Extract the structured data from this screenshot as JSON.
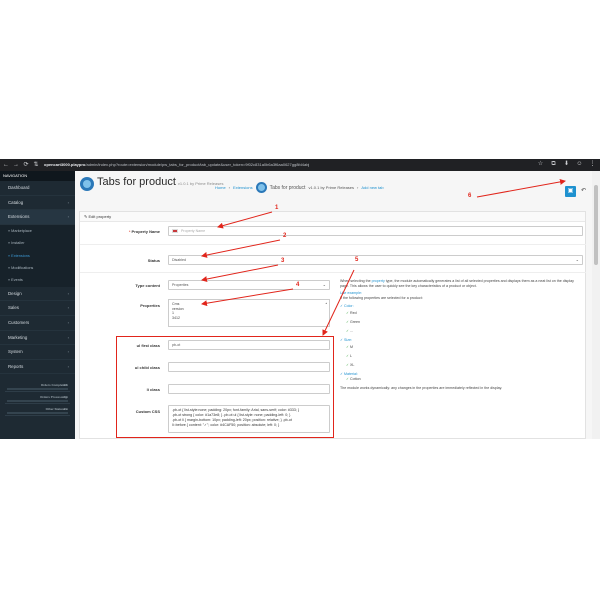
{
  "browser": {
    "url_host": "opencart3000.playpro",
    "url_path": "/admin/index.php?route=extension/module/pw_tabs_for_product/tab_update&user_token=9f02c831a0b6a3f6aa0627gg8fd4abj",
    "buttons": [
      "←",
      "→",
      "⟳",
      "⇅"
    ],
    "right_icons": [
      "☆",
      "⧉",
      "⬇",
      "☺",
      "⋮"
    ]
  },
  "nav": {
    "header": "NAVIGATION",
    "items": [
      {
        "label": "Dashboard",
        "arrow": ""
      },
      {
        "label": "Catalog",
        "arrow": "›"
      },
      {
        "label": "Extensions",
        "arrow": "›"
      },
      {
        "label": "Design",
        "arrow": "›"
      },
      {
        "label": "Sales",
        "arrow": "›"
      },
      {
        "label": "Customers",
        "arrow": "›"
      },
      {
        "label": "Marketing",
        "arrow": "›"
      },
      {
        "label": "System",
        "arrow": "›"
      },
      {
        "label": "Reports",
        "arrow": "›"
      }
    ],
    "subitems": [
      "» Marketplace",
      "» Installer",
      "» Extensions",
      "» Modifications",
      "» Events"
    ],
    "stats": [
      {
        "label": "Orders Completed",
        "pct": "0%",
        "value": 0.0
      },
      {
        "label": "Orders Processing",
        "pct": "0%",
        "value": 0.0
      },
      {
        "label": "Other Statuses",
        "pct": "0%",
        "value": 0.0
      }
    ]
  },
  "header": {
    "title": "Tabs for product",
    "version": "v1.0.1 by Prime Releases",
    "crumb_home": "Home",
    "crumb_ext": "Extensions",
    "crumb_module": "Tabs for product",
    "crumb_module_ver": "v1.0.1 by Prime Releases",
    "crumb_add": "Add new tab",
    "save_icon": "floppy-icon",
    "save_glyph": "▣",
    "back_glyph": "↶"
  },
  "panel": {
    "heading": "✎ Edit property"
  },
  "form": {
    "property_name_label": "Property Name",
    "property_name_required": "* ",
    "property_name_placeholder": "Property Name",
    "status_label": "Status",
    "status_value": "Disabled",
    "type_label": "Type content",
    "type_value": "Properties",
    "properties_label": "Properties",
    "properties_lines": [
      "Cms",
      "version",
      "1",
      "3412"
    ],
    "ul_first_label": "ul first class",
    "ul_first_value": "pb-ot",
    "ul_child_label": "ul child class",
    "ul_child_value": "",
    "li_label": "li class",
    "li_value": "",
    "css_label": "Custom CSS",
    "css_value": ".pb-ot { list-style:none; padding: 20px; font-family: Arial, sans-serif; color: #333; }\n.pb-ot strong { color: #1a73e8; } .pb-ot ul { list-style: none; padding-left: 0; }\n.pb-ot li { margin-bottom: 10px; padding-left: 20px; position: relative; } .pb-ot\nli::before { content: \"✓\"; color: #4CAF50; position: absolute; left: 0; }"
  },
  "help": {
    "intro_a": "When selecting the ",
    "intro_link": "property",
    "intro_b": " type, the module automatically generates a list of all selected properties and displays them as a neat list on the display page. This allows the user to quickly see the key characteristics of a product or object.",
    "example_title": "Use example:",
    "example_lead": "If the following properties are selected for a product:",
    "groups": [
      {
        "name": "Color:",
        "values": [
          "Red",
          "Green",
          "..."
        ]
      },
      {
        "name": "Size:",
        "values": [
          "M",
          "L",
          "XL"
        ]
      },
      {
        "name": "Material:",
        "values": [
          "Cotton"
        ]
      }
    ],
    "footer": "The module works dynamically: any changes in the properties are immediately reflected in the display."
  },
  "annotations": {
    "numbers": [
      "1",
      "2",
      "3",
      "4",
      "5",
      "6"
    ],
    "color": "#e1251b"
  },
  "colors": {
    "accent": "#1e91cf",
    "nav_bg": "#1e2a33"
  }
}
